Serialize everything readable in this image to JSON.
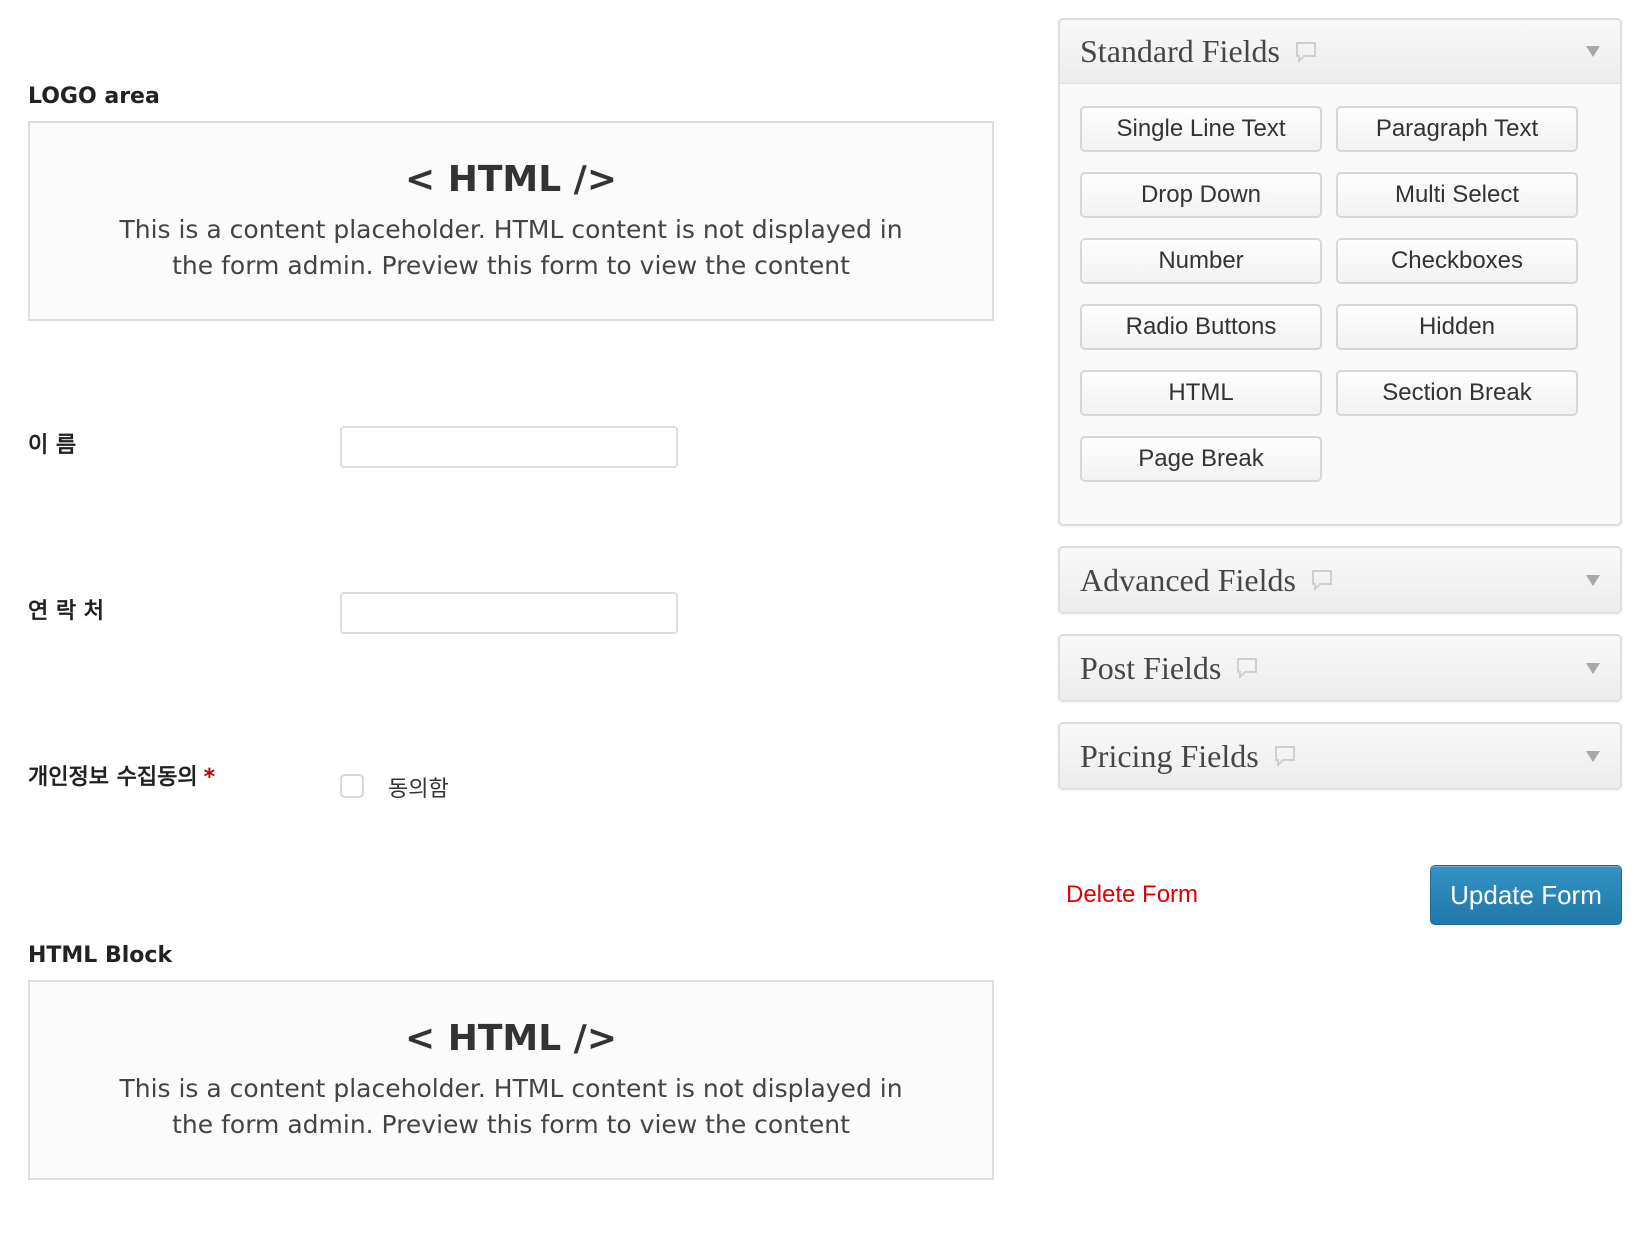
{
  "form": {
    "logo_block": {
      "label": "LOGO area",
      "tag": "< HTML />",
      "desc_line1": "This is a content placeholder. HTML content is not displayed in",
      "desc_line2": "the form admin. Preview this form to view the content"
    },
    "name_field": {
      "label": "이 름",
      "value": ""
    },
    "contact_field": {
      "label": "연 락 처",
      "value": ""
    },
    "consent_field": {
      "label": "개인정보 수집동의",
      "required_mark": "*",
      "checkbox_label": "동의함",
      "checked": false
    },
    "html_block": {
      "label": "HTML Block",
      "tag": "< HTML />",
      "desc_line1": "This is a content placeholder. HTML content is not displayed in",
      "desc_line2": "the form admin. Preview this form to view the content"
    }
  },
  "sidebar": {
    "standard_fields": {
      "title": "Standard Fields",
      "buttons": [
        "Single Line Text",
        "Paragraph Text",
        "Drop Down",
        "Multi Select",
        "Number",
        "Checkboxes",
        "Radio Buttons",
        "Hidden",
        "HTML",
        "Section Break",
        "Page Break"
      ]
    },
    "advanced_fields": {
      "title": "Advanced Fields"
    },
    "post_fields": {
      "title": "Post Fields"
    },
    "pricing_fields": {
      "title": "Pricing Fields"
    },
    "icons": {
      "tooltip": "speech-bubble-icon",
      "toggle": "triangle-down-icon"
    }
  },
  "actions": {
    "delete_label": "Delete Form",
    "update_label": "Update Form"
  },
  "colors": {
    "delete_link": "#e00000",
    "update_button": "#2a86b8",
    "required_star": "#b30000"
  }
}
